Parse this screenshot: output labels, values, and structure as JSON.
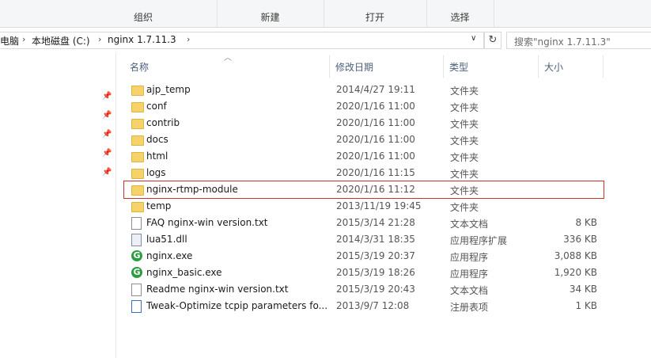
{
  "ribbon": {
    "groups": [
      {
        "label": "组织"
      },
      {
        "label": "新建"
      },
      {
        "label": "打开"
      },
      {
        "label": "选择"
      }
    ]
  },
  "address": {
    "crumbs": [
      "电脑",
      "本地磁盘 (C:)",
      "nginx 1.7.11.3"
    ],
    "search_placeholder": "搜索\"nginx 1.7.11.3\""
  },
  "columns": {
    "name": "名称",
    "date": "修改日期",
    "type": "类型",
    "size": "大小"
  },
  "files": [
    {
      "name": "ajp_temp",
      "date": "2014/4/27 19:11",
      "type": "文件夹",
      "size": "",
      "icon": "folder-icon"
    },
    {
      "name": "conf",
      "date": "2020/1/16 11:00",
      "type": "文件夹",
      "size": "",
      "icon": "folder-icon"
    },
    {
      "name": "contrib",
      "date": "2020/1/16 11:00",
      "type": "文件夹",
      "size": "",
      "icon": "folder-icon"
    },
    {
      "name": "docs",
      "date": "2020/1/16 11:00",
      "type": "文件夹",
      "size": "",
      "icon": "folder-icon"
    },
    {
      "name": "html",
      "date": "2020/1/16 11:00",
      "type": "文件夹",
      "size": "",
      "icon": "folder-icon"
    },
    {
      "name": "logs",
      "date": "2020/1/16 11:15",
      "type": "文件夹",
      "size": "",
      "icon": "folder-icon"
    },
    {
      "name": "nginx-rtmp-module",
      "date": "2020/1/16 11:12",
      "type": "文件夹",
      "size": "",
      "icon": "folder-icon",
      "highlighted": true
    },
    {
      "name": "temp",
      "date": "2013/11/19 19:45",
      "type": "文件夹",
      "size": "",
      "icon": "folder-icon"
    },
    {
      "name": "FAQ nginx-win version.txt",
      "date": "2015/3/14 21:28",
      "type": "文本文档",
      "size": "8 KB",
      "icon": "text-file-icon"
    },
    {
      "name": "lua51.dll",
      "date": "2014/3/31 18:35",
      "type": "应用程序扩展",
      "size": "336 KB",
      "icon": "dll-file-icon"
    },
    {
      "name": "nginx.exe",
      "date": "2015/3/19 20:37",
      "type": "应用程序",
      "size": "3,088 KB",
      "icon": "nginx-exe-icon"
    },
    {
      "name": "nginx_basic.exe",
      "date": "2015/3/19 18:26",
      "type": "应用程序",
      "size": "1,920 KB",
      "icon": "nginx-exe-icon"
    },
    {
      "name": "Readme nginx-win version.txt",
      "date": "2015/3/19 20:43",
      "type": "文本文档",
      "size": "34 KB",
      "icon": "text-file-icon"
    },
    {
      "name": "Tweak-Optimize tcpip parameters fo...",
      "date": "2013/9/7 12:08",
      "type": "注册表项",
      "size": "1 KB",
      "icon": "registry-file-icon"
    }
  ],
  "colors": {
    "highlight_outline": "#c8332e",
    "folder": "#f6d26b",
    "nginx_green": "#2b9d3f"
  }
}
